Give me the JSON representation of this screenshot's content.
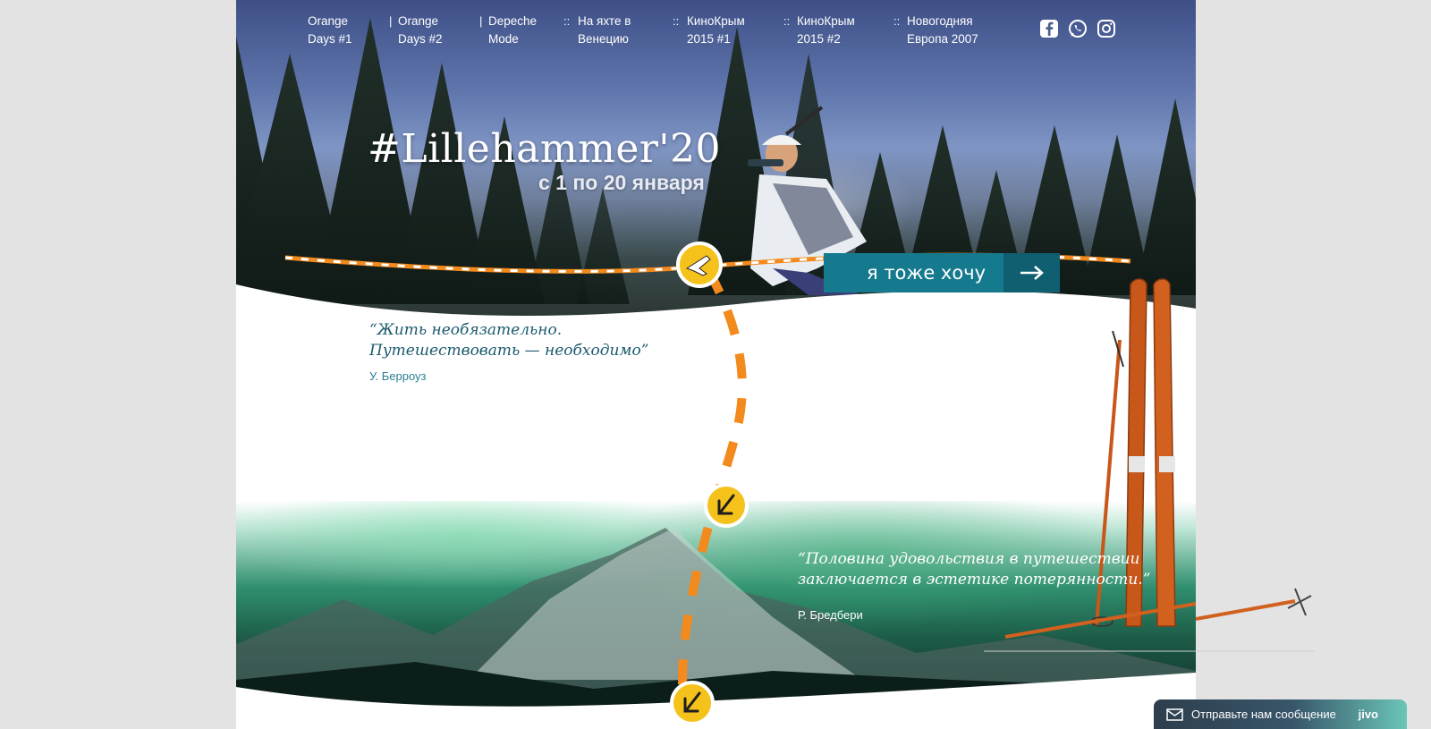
{
  "nav": {
    "items": [
      {
        "label": "Orange Days #1"
      },
      {
        "label": "Orange Days #2"
      },
      {
        "label": "Depeche Mode"
      },
      {
        "label": "На яхте в Венецию"
      },
      {
        "label": "КиноКрым 2015 #1"
      },
      {
        "label": "КиноКрым 2015 #2"
      },
      {
        "label": "Новогодняя Европа 2007"
      }
    ],
    "separators": [
      "|",
      "|",
      "::",
      "::",
      "::",
      "::"
    ],
    "social": [
      "facebook-icon",
      "whatsapp-icon",
      "instagram-icon"
    ]
  },
  "hero": {
    "title": "#Lillehammer'20",
    "dates": "с 1 по 20 января",
    "cta_label": "я тоже хочу"
  },
  "quote1": {
    "line1": "“Жить необязательно.",
    "line2": "Путешествовать — необходимо”",
    "author": "У. Берроуз"
  },
  "quote2": {
    "line1": "“Половина удовольствия в путешествии",
    "line2": "заключается в эстетике потерянности.”",
    "author": "Р. Бредбери"
  },
  "chat": {
    "label": "Отправьте нам сообщение",
    "brand": "jivo"
  },
  "colors": {
    "accent_orange": "#f28a1e",
    "teal": "#157a8e",
    "marker_yellow": "#f5c21b"
  }
}
